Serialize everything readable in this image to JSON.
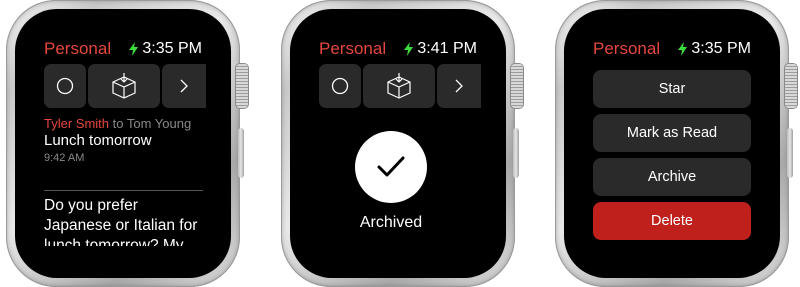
{
  "colors": {
    "accent_red": "#e5473f",
    "battery_green": "#3ddc3d",
    "delete_red": "#c0201b",
    "button_gray": "#2a2a2a"
  },
  "watches": [
    {
      "status": {
        "app": "Personal",
        "time": "3:35 PM"
      },
      "actions": [
        "circle-icon",
        "archive-box-icon",
        "chevron-right-icon"
      ],
      "message": {
        "from": "Tyler Smith",
        "to_prefix": "to",
        "to": "Tom Young",
        "subject": "Lunch tomorrow",
        "received": "9:42 AM",
        "body": "Do you prefer Japanese or Italian for lunch tomorrow? My"
      }
    },
    {
      "status": {
        "app": "Personal",
        "time": "3:41 PM"
      },
      "actions": [
        "circle-icon",
        "archive-box-icon",
        "chevron-right-icon"
      ],
      "confirmation": {
        "icon": "checkmark-icon",
        "label": "Archived"
      }
    },
    {
      "status": {
        "app": "Personal",
        "time": "3:35 PM"
      },
      "menu": [
        "Star",
        "Mark as Read",
        "Archive",
        "Delete"
      ]
    }
  ]
}
